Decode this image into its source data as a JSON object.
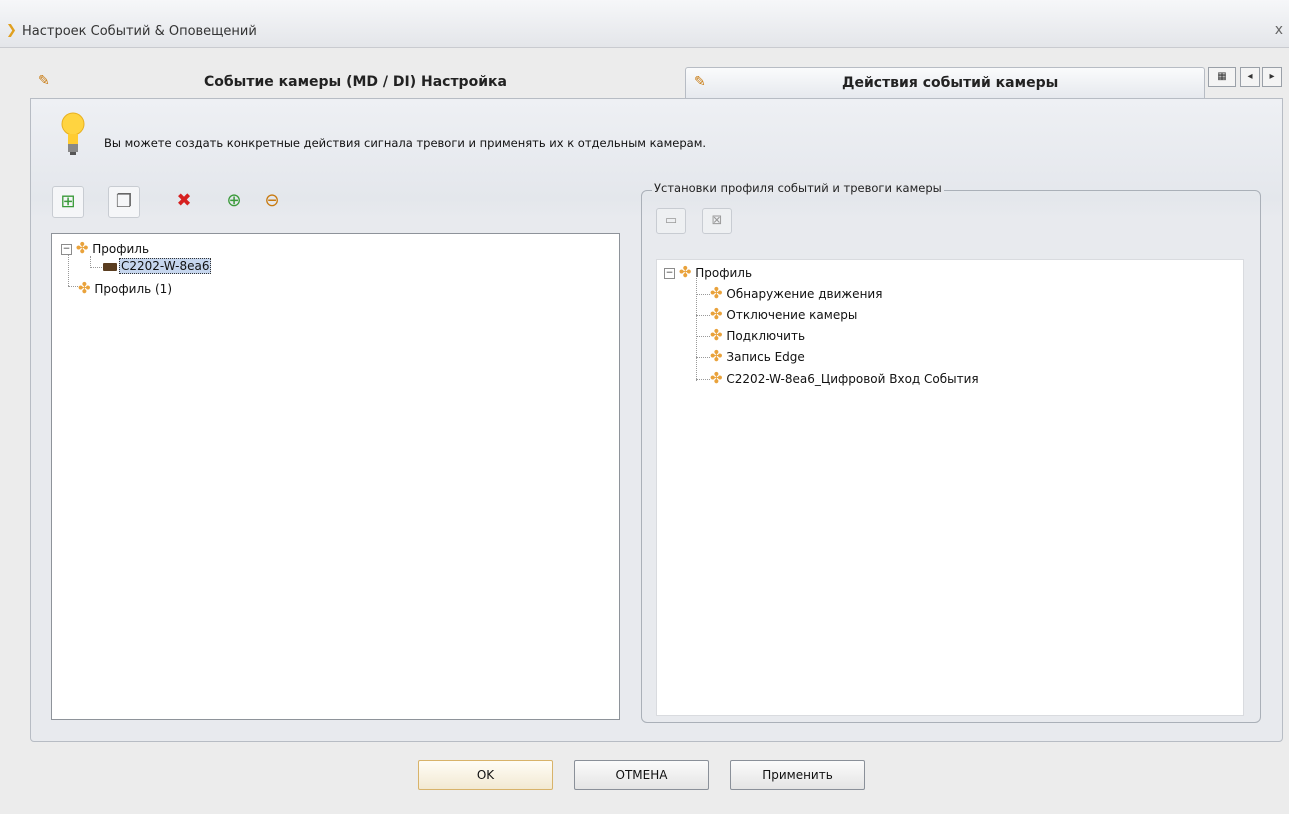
{
  "window": {
    "title": "Настроек Событий & Оповещений",
    "close": "x"
  },
  "tabs": [
    {
      "label": "Событие камеры (MD / DI) Настройка"
    },
    {
      "label": "Действия событий камеры"
    }
  ],
  "hint": {
    "text": "Вы можете создать конкретные действия сигнала тревоги и применять их к отдельным камерам."
  },
  "left_tree": {
    "profile": "Профиль",
    "camera": "C2202-W-8ea6",
    "profile1": "Профиль (1)"
  },
  "right_group": {
    "legend": "Установки профиля событий и тревоги камеры",
    "root": "Профиль",
    "items": [
      "Обнаружение движения",
      "Отключение камеры",
      "Подключить",
      "Запись Edge",
      "C2202-W-8ea6_Цифровой Вход События"
    ]
  },
  "buttons": {
    "ok": "OK",
    "cancel": "ОТМЕНА",
    "apply": "Применить"
  },
  "colors": {
    "accent": "#e9a23b",
    "delete": "#d62020",
    "add": "#3a9a3a"
  }
}
